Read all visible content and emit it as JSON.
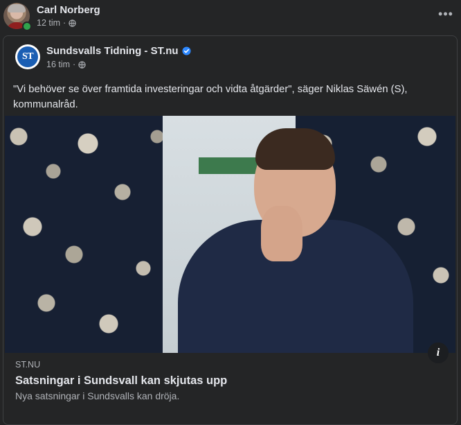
{
  "post": {
    "author": "Carl Norberg",
    "time": "12 tim",
    "separator": "·",
    "more_label": "•••"
  },
  "shared": {
    "source_name": "Sundsvalls Tidning - ST.nu",
    "logo_text": "ST",
    "time": "16 tim",
    "separator": "·",
    "text": "\"Vi behöver se över framtida investeringar och vidta åtgärder\", säger Niklas Säwén (S), kommunalråd.",
    "info_label": "i",
    "link": {
      "domain": "ST.NU",
      "title": "Satsningar i Sundsvall kan skjutas upp",
      "description": "Nya satsningar i Sundsvalls kan dröja."
    }
  },
  "colors": {
    "background": "#242526",
    "primary_text": "#e4e6eb",
    "secondary_text": "#b0b3b8",
    "verified": "#2d88ff",
    "online": "#31a24c"
  },
  "icons": [
    "globe-icon",
    "verified-icon",
    "more-icon",
    "info-icon"
  ]
}
